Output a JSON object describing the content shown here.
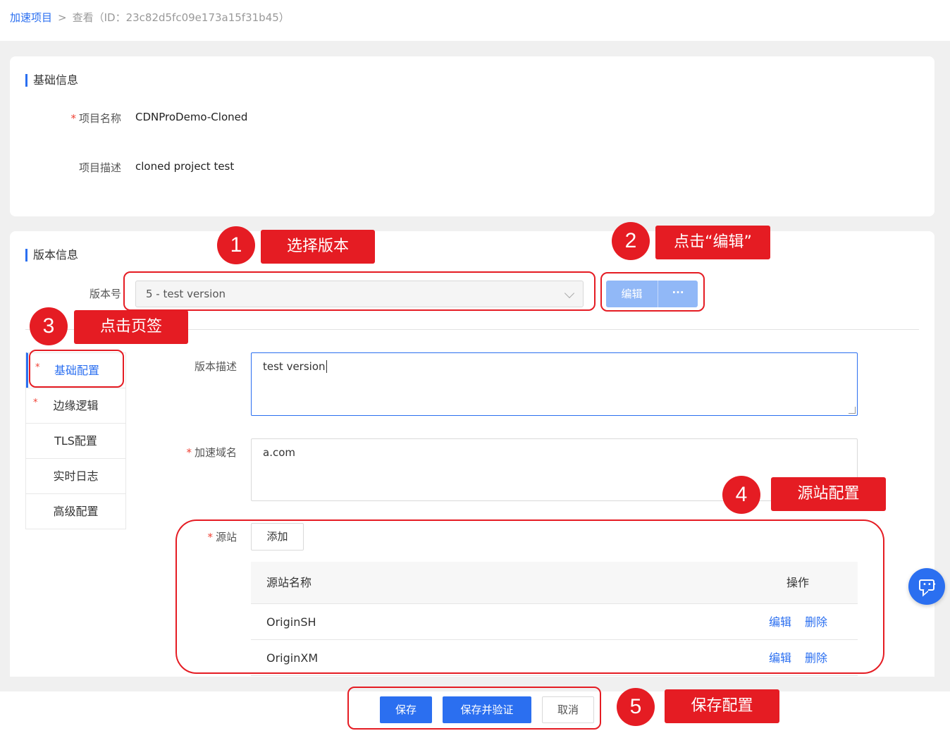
{
  "breadcrumb": {
    "root": "加速项目",
    "separator": ">",
    "current": "查看（ID：23c82d5fc09e173a15f31b45）"
  },
  "basic_info": {
    "title": "基础信息",
    "fields": [
      {
        "label": "项目名称",
        "required": "*",
        "value": "CDNProDemo-Cloned"
      },
      {
        "label": "项目描述",
        "value": "cloned project test"
      }
    ]
  },
  "version_info": {
    "title": "版本信息",
    "version_label": "版本号",
    "version_selected": "5 - test version",
    "edit_button": "编辑",
    "more_button": "···"
  },
  "tabs": [
    {
      "label": "基础配置",
      "required": "*",
      "active": true
    },
    {
      "label": "边缘逻辑",
      "required": "*"
    },
    {
      "label": "TLS配置"
    },
    {
      "label": "实时日志"
    },
    {
      "label": "高级配置"
    }
  ],
  "form": {
    "version_desc_label": "版本描述",
    "version_desc_value": "test version",
    "domain_label": "加速域名",
    "domain_required": "*",
    "domain_value": "a.com",
    "origin_label": "源站",
    "origin_required": "*",
    "add_button": "添加"
  },
  "origin_table": {
    "headers": {
      "name": "源站名称",
      "ops": "操作"
    },
    "rows": [
      {
        "name": "OriginSH",
        "edit": "编辑",
        "delete": "删除"
      },
      {
        "name": "OriginXM",
        "edit": "编辑",
        "delete": "删除"
      }
    ]
  },
  "footer": {
    "save": "保存",
    "save_verify": "保存并验证",
    "cancel": "取消"
  },
  "annotations": [
    {
      "num": "1",
      "text": "选择版本"
    },
    {
      "num": "2",
      "text": "点击“编辑”"
    },
    {
      "num": "3",
      "text": "点击页签"
    },
    {
      "num": "4",
      "text": "源站配置"
    },
    {
      "num": "5",
      "text": "保存配置"
    }
  ],
  "colors": {
    "accent": "#2b6ff0",
    "annotation_red": "#e51c23",
    "disabled_button": "#91b8f7"
  }
}
